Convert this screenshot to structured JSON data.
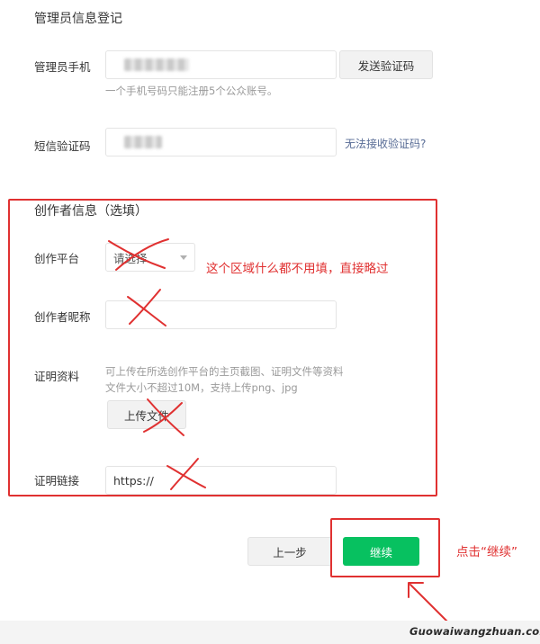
{
  "admin_section": {
    "title": "管理员信息登记",
    "phone_label": "管理员手机",
    "send_code_button": "发送验证码",
    "phone_hint": "一个手机号码只能注册5个公众账号。",
    "sms_label": "短信验证码",
    "cannot_receive_link": "无法接收验证码?"
  },
  "creator_section": {
    "title": "创作者信息（选填）",
    "platform_label": "创作平台",
    "platform_select_value": "请选择",
    "nickname_label": "创作者昵称",
    "proof_label": "证明资料",
    "proof_hint_line1": "可上传在所选创作平台的主页截图、证明文件等资料",
    "proof_hint_line2": "文件大小不超过10M，支持上传png、jpg",
    "upload_button": "上传文件",
    "link_label": "证明链接",
    "link_value": "https://"
  },
  "annotations": {
    "skip_note": "这个区域什么都不用填，直接略过",
    "click_note": "点击“继续”",
    "color": "#e03131"
  },
  "footer": {
    "prev_button": "上一步",
    "continue_button": "继续",
    "watermark": "Guowaiwangzhuan.com"
  },
  "colors": {
    "primary_green": "#07c160",
    "link_blue": "#576b95"
  }
}
